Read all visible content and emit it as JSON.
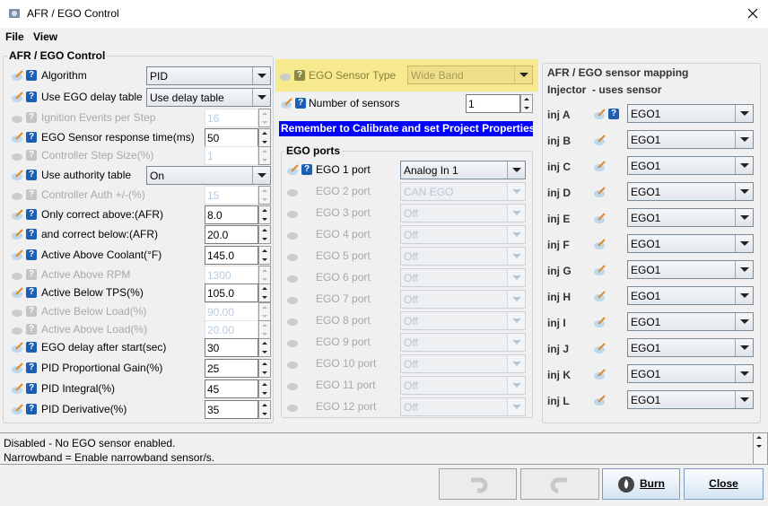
{
  "window": {
    "title": "AFR / EGO Control",
    "close_icon": "close-icon"
  },
  "menu": {
    "file": "File",
    "view": "View"
  },
  "left": {
    "title": "AFR / EGO Control",
    "rows": [
      {
        "label": "Algorithm",
        "type": "combo",
        "value": "PID",
        "enabled": true
      },
      {
        "label": "Use EGO delay table",
        "type": "combo",
        "value": "Use delay table",
        "enabled": true
      },
      {
        "label": "Ignition Events per Step",
        "type": "spin",
        "value": "16",
        "enabled": false
      },
      {
        "label": "EGO Sensor response time(ms)",
        "type": "spin",
        "value": "50",
        "enabled": true
      },
      {
        "label": "Controller Step Size(%)",
        "type": "spin",
        "value": "1",
        "enabled": false
      },
      {
        "label": "Use authority table",
        "type": "combo",
        "value": "On",
        "enabled": true
      },
      {
        "label": "Controller Auth +/-(%)",
        "type": "spin",
        "value": "15",
        "enabled": false
      },
      {
        "label": "Only correct above:(AFR)",
        "type": "spin",
        "value": "8.0",
        "enabled": true
      },
      {
        "label": "and correct below:(AFR)",
        "type": "spin",
        "value": "20.0",
        "enabled": true
      },
      {
        "label": "Active Above Coolant(°F)",
        "type": "spin",
        "value": "145.0",
        "enabled": true
      },
      {
        "label": "Active Above RPM",
        "type": "spin",
        "value": "1300",
        "enabled": false
      },
      {
        "label": "Active Below TPS(%)",
        "type": "spin",
        "value": "105.0",
        "enabled": true
      },
      {
        "label": "Active Below Load(%)",
        "type": "spin",
        "value": "90.00",
        "enabled": false
      },
      {
        "label": "Active Above Load(%)",
        "type": "spin",
        "value": "20.00",
        "enabled": false
      },
      {
        "label": "EGO delay after start(sec)",
        "type": "spin",
        "value": "30",
        "enabled": true
      },
      {
        "label": "PID Proportional Gain(%)",
        "type": "spin",
        "value": "25",
        "enabled": true
      },
      {
        "label": "PID Integral(%)",
        "type": "spin",
        "value": "45",
        "enabled": true
      },
      {
        "label": "PID Derivative(%)",
        "type": "spin",
        "value": "35",
        "enabled": true
      }
    ]
  },
  "middle": {
    "sensor_type": {
      "label": "EGO Sensor Type",
      "value": "Wide Band",
      "highlight": "#f7e98e"
    },
    "num_sensors": {
      "label": "Number of sensors",
      "value": "1"
    },
    "banner": {
      "text": "Remember to Calibrate and set Project Properties",
      "bg": "#0000ff"
    },
    "ports_title": "EGO ports",
    "ports": [
      {
        "label": "EGO 1 port",
        "value": "Analog In 1",
        "enabled": true
      },
      {
        "label": "EGO 2 port",
        "value": "CAN EGO",
        "enabled": false
      },
      {
        "label": "EGO 3 port",
        "value": "Off",
        "enabled": false
      },
      {
        "label": "EGO 4 port",
        "value": "Off",
        "enabled": false
      },
      {
        "label": "EGO 5 port",
        "value": "Off",
        "enabled": false
      },
      {
        "label": "EGO 6 port",
        "value": "Off",
        "enabled": false
      },
      {
        "label": "EGO 7 port",
        "value": "Off",
        "enabled": false
      },
      {
        "label": "EGO 8 port",
        "value": "Off",
        "enabled": false
      },
      {
        "label": "EGO 9 port",
        "value": "Off",
        "enabled": false
      },
      {
        "label": "EGO 10 port",
        "value": "Off",
        "enabled": false
      },
      {
        "label": "EGO 11 port",
        "value": "Off",
        "enabled": false
      },
      {
        "label": "EGO 12 port",
        "value": "Off",
        "enabled": false
      }
    ]
  },
  "right": {
    "title": "AFR / EGO sensor mapping",
    "header": "Injector  - uses sensor",
    "rows": [
      {
        "label": "inj A",
        "value": "EGO1"
      },
      {
        "label": "inj B",
        "value": "EGO1"
      },
      {
        "label": "inj C",
        "value": "EGO1"
      },
      {
        "label": "inj D",
        "value": "EGO1"
      },
      {
        "label": "inj E",
        "value": "EGO1"
      },
      {
        "label": "inj F",
        "value": "EGO1"
      },
      {
        "label": "inj G",
        "value": "EGO1"
      },
      {
        "label": "inj H",
        "value": "EGO1"
      },
      {
        "label": "inj I",
        "value": "EGO1"
      },
      {
        "label": "inj J",
        "value": "EGO1"
      },
      {
        "label": "inj K",
        "value": "EGO1"
      },
      {
        "label": "inj L",
        "value": "EGO1"
      }
    ]
  },
  "help_text": {
    "line1": "Disabled - No EGO sensor enabled.",
    "line2": "Narrowband = Enable narrowband sensor/s."
  },
  "buttons": {
    "undo_icon": "undo-icon",
    "redo_icon": "redo-icon",
    "burn": "Burn",
    "close": "Close"
  }
}
